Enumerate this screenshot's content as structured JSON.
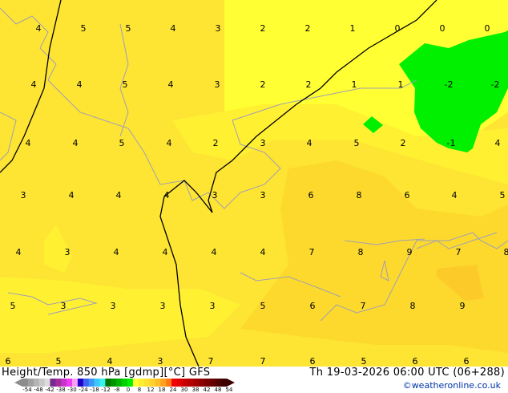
{
  "title": "Height/Temp. 850 hPa [gdmp][°C] GFS",
  "datetime": "Th 19-03-2026 06:00 UTC (06+288)",
  "credit": "©weatheronline.co.uk",
  "colorbar": {
    "ticks": [
      "-54",
      "-48",
      "-42",
      "-38",
      "-30",
      "-24",
      "-18",
      "-12",
      "-8",
      "0",
      "8",
      "12",
      "18",
      "24",
      "30",
      "38",
      "42",
      "48",
      "54"
    ],
    "colors": [
      "#8c8c8c",
      "#a0a0a0",
      "#b4b4b4",
      "#c8c8c8",
      "#dcdcdc",
      "#78288c",
      "#a02ca0",
      "#c832c8",
      "#f03cf0",
      "#f8a0f8",
      "#1e00c8",
      "#3c64f0",
      "#3c96f8",
      "#3cc8f8",
      "#3cf0f0",
      "#007800",
      "#009600",
      "#00b400",
      "#00d200",
      "#00f000",
      "#ffff32",
      "#fff032",
      "#ffe132",
      "#ffd232",
      "#ffbe28",
      "#ffa01e",
      "#ff7814",
      "#f00000",
      "#dc0000",
      "#c80000",
      "#b40000",
      "#a00000",
      "#8c0000",
      "#780000",
      "#640000",
      "#500000",
      "#3c0000"
    ]
  },
  "colors": {
    "t0": "#ffff33",
    "t2": "#fff032",
    "t4": "#fee433",
    "t6": "#fdd92e",
    "t8": "#fccb2a",
    "green": "#00f000",
    "coast": "#a0a0b4"
  },
  "labels": [
    "4",
    "5",
    "5",
    "4",
    "3",
    "2",
    "2",
    "1",
    "0",
    "0",
    "0",
    "4",
    "4",
    "5",
    "4",
    "3",
    "2",
    "2",
    "1",
    "1",
    "-2",
    "-2",
    "4",
    "4",
    "5",
    "4",
    "2",
    "3",
    "4",
    "5",
    "2",
    "-1",
    "4",
    "3",
    "4",
    "4",
    "4",
    "3",
    "3",
    "6",
    "8",
    "6",
    "4",
    "5",
    "4",
    "3",
    "4",
    "4",
    "4",
    "4",
    "7",
    "8",
    "9",
    "7",
    "8",
    "5",
    "3",
    "3",
    "3",
    "3",
    "5",
    "6",
    "7",
    "8",
    "9",
    "6",
    "5",
    "4",
    "3",
    "7",
    "7",
    "6",
    "5",
    "6",
    "6"
  ]
}
